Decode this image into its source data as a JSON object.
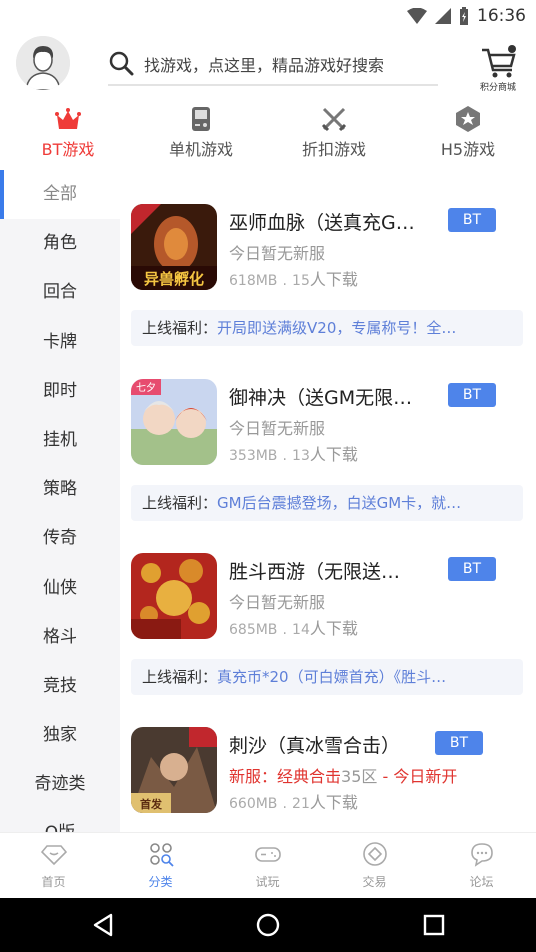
{
  "status_bar": {
    "time": "16:36"
  },
  "header": {
    "search_placeholder": "找游戏，点这里，精品游戏好搜索",
    "points_shop_label": "积分商城"
  },
  "tabs": [
    {
      "label": "BT游戏",
      "icon": "crown-icon"
    },
    {
      "label": "单机游戏",
      "icon": "gameboy-icon"
    },
    {
      "label": "折扣游戏",
      "icon": "swords-icon"
    },
    {
      "label": "H5游戏",
      "icon": "star-hexagon-icon"
    }
  ],
  "sidebar": {
    "items": [
      "全部",
      "角色",
      "回合",
      "卡牌",
      "即时",
      "挂机",
      "策略",
      "传奇",
      "仙侠",
      "格斗",
      "竞技",
      "独家",
      "奇迹类",
      "Q版"
    ]
  },
  "games": [
    {
      "title": "巫师血脉（送真充G…",
      "badge": "BT",
      "line2": "今日暂无新服",
      "size": "618MB",
      "sep": ".",
      "downloads_num": "15",
      "downloads_unit": "人下载",
      "perk_key": "上线福利：",
      "perk_val": "开局即送满级V20，专属称号！全…",
      "icon_caption": "异兽孵化"
    },
    {
      "title": "御神决（送GM无限…",
      "badge": "BT",
      "line2": "今日暂无新服",
      "size": "353MB",
      "sep": ".",
      "downloads_num": "13",
      "downloads_unit": "人下载",
      "perk_key": "上线福利：",
      "perk_val": "GM后台震撼登场，白送GM卡，就…",
      "icon_caption": "七夕"
    },
    {
      "title": "胜斗西游（无限送…",
      "badge": "BT",
      "line2": "今日暂无新服",
      "size": "685MB",
      "sep": ".",
      "downloads_num": "14",
      "downloads_unit": "人下载",
      "perk_key": "上线福利：",
      "perk_val": "真充币*20（可白嫖首充）《胜斗…",
      "icon_caption": ""
    },
    {
      "title": "刺沙（真冰雪合击）",
      "badge": "BT",
      "newserver_label": "新服：经典合击",
      "newserver_num": "35区",
      "newserver_sep": " - ",
      "newserver_when": "今日新开",
      "size": "660MB",
      "sep": ".",
      "downloads_num": "21",
      "downloads_unit": "人下载",
      "icon_caption": "首发"
    }
  ],
  "bottom_nav": [
    {
      "label": "首页",
      "icon": "diamond-icon"
    },
    {
      "label": "分类",
      "icon": "category-icon"
    },
    {
      "label": "试玩",
      "icon": "gamepad-icon"
    },
    {
      "label": "交易",
      "icon": "trade-icon"
    },
    {
      "label": "论坛",
      "icon": "chat-icon"
    }
  ],
  "colors": {
    "accent_red": "#ef3b38",
    "accent_blue": "#4e84ea",
    "perk_text": "#5e7fd8",
    "sidebar_bg": "#f5f5f7"
  }
}
